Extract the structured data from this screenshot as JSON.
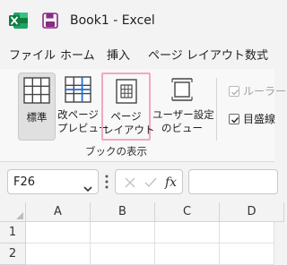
{
  "titlebar": {
    "title": "Book1  -  Excel",
    "app_icon": "excel-icon",
    "save_icon": "save-icon",
    "brand_color": "#107c41",
    "save_color": "#8a2b87"
  },
  "tabs": [
    "ファイル",
    "ホーム",
    "挿入",
    "ページ レイアウト",
    "数式"
  ],
  "ribbon": {
    "buttons": [
      {
        "label_line1": "標準",
        "label_line2": "",
        "icon": "normal-view-icon",
        "state": "selected"
      },
      {
        "label_line1": "改ページ",
        "label_line2": "プレビュー",
        "icon": "page-break-preview-icon",
        "state": "normal"
      },
      {
        "label_line1": "ページ",
        "label_line2": "レイアウト",
        "icon": "page-layout-icon",
        "state": "highlighted"
      },
      {
        "label_line1": "ユーザー設定",
        "label_line2": "のビュー",
        "icon": "custom-views-icon",
        "state": "normal"
      }
    ],
    "group_label": "ブックの表示",
    "checkboxes": [
      {
        "label": "ルーラー",
        "checked": true,
        "disabled": true
      },
      {
        "label": "目盛線",
        "checked": true,
        "disabled": false
      }
    ],
    "highlight_color": "#f2a6c6"
  },
  "formula_bar": {
    "name_box": "F26",
    "fx_label": "fx",
    "formula": ""
  },
  "grid": {
    "columns": [
      "A",
      "B",
      "C",
      "D"
    ],
    "rows": [
      "1",
      "2"
    ]
  }
}
